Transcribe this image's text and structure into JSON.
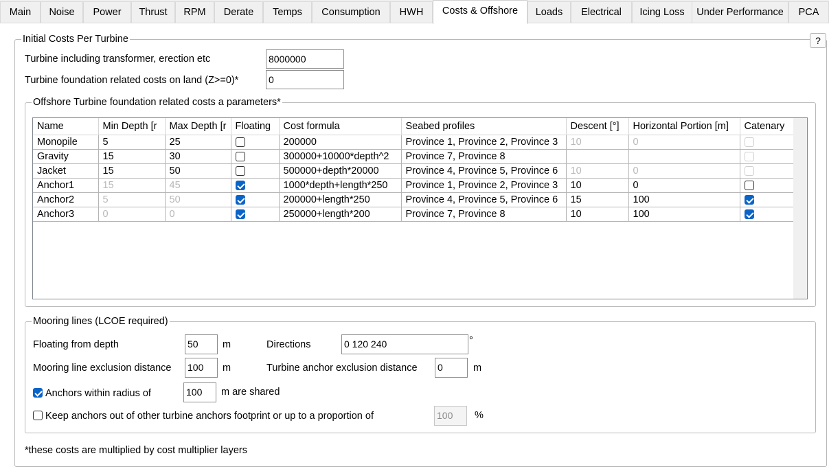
{
  "tabs": [
    "Main",
    "Noise",
    "Power",
    "Thrust",
    "RPM",
    "Derate",
    "Temps",
    "Consumption",
    "HWH",
    "Costs & Offshore",
    "Loads",
    "Electrical",
    "Icing Loss",
    "Under Performance",
    "PCA"
  ],
  "help_label": "?",
  "initial": {
    "legend": "Initial Costs Per Turbine",
    "turbine_label": "Turbine including transformer, erection etc",
    "turbine_value": "8000000",
    "foundation_label": "Turbine foundation related costs on land (Z>=0)*",
    "foundation_value": "0"
  },
  "offshore": {
    "legend": "Offshore Turbine foundation related costs a parameters*",
    "columns": [
      "Name",
      "Min Depth [r",
      "Max Depth [r",
      "Floating",
      "Cost formula",
      "Seabed profiles",
      "Descent [°]",
      "Horizontal Portion [m]",
      "Catenary"
    ],
    "rows": [
      {
        "name": "Monopile",
        "min": "5",
        "max": "25",
        "floating": false,
        "formula": "200000",
        "seabed": "Province 1, Province 2, Province 3",
        "descent": "10",
        "horizontal": "0",
        "catenary": false
      },
      {
        "name": "Gravity",
        "min": "15",
        "max": "30",
        "floating": false,
        "formula": "300000+10000*depth^2",
        "seabed": "Province 7, Province 8",
        "descent": "",
        "horizontal": "",
        "catenary": false
      },
      {
        "name": "Jacket",
        "min": "15",
        "max": "50",
        "floating": false,
        "formula": "500000+depth*20000",
        "seabed": "Province 4, Province 5, Province 6",
        "descent": "10",
        "horizontal": "0",
        "catenary": false
      },
      {
        "name": "Anchor1",
        "min": "15",
        "max": "45",
        "floating": true,
        "formula": "1000*depth+length*250",
        "seabed": "Province 1, Province 2, Province 3",
        "descent": "10",
        "horizontal": "0",
        "catenary": false
      },
      {
        "name": "Anchor2",
        "min": "5",
        "max": "50",
        "floating": true,
        "formula": "200000+length*250",
        "seabed": "Province 4, Province 5, Province 6",
        "descent": "15",
        "horizontal": "100",
        "catenary": true
      },
      {
        "name": "Anchor3",
        "min": "0",
        "max": "0",
        "floating": true,
        "formula": "250000+length*200",
        "seabed": "Province 7, Province 8",
        "descent": "10",
        "horizontal": "100",
        "catenary": true
      }
    ]
  },
  "mooring": {
    "legend": "Mooring lines (LCOE required)",
    "floating_label": "Floating from depth",
    "floating_value": "50",
    "floating_unit": "m",
    "directions_label": "Directions",
    "directions_value": "0 120 240",
    "directions_unit": "°",
    "exclusion_label": "Mooring line exclusion distance",
    "exclusion_value": "100",
    "exclusion_unit": "m",
    "anchor_excl_label": "Turbine anchor exclusion distance",
    "anchor_excl_value": "0",
    "anchor_excl_unit": "m",
    "shared_checked": true,
    "shared_label": "Anchors within radius of",
    "shared_value": "100",
    "shared_unit": "m are shared",
    "footprint_checked": false,
    "footprint_label": "Keep anchors out of other turbine anchors footprint or up to a proportion of",
    "footprint_value": "100",
    "footprint_unit": "%"
  },
  "footnote": "*these costs are multiplied by cost multiplier layers"
}
